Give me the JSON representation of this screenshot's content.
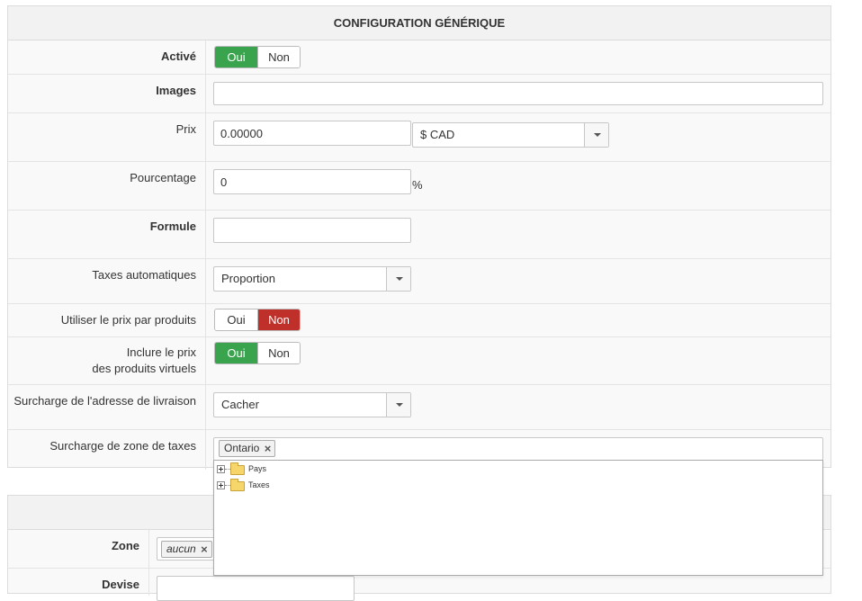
{
  "panel": {
    "title": "CONFIGURATION GÉNÉRIQUE"
  },
  "active": {
    "label": "Activé",
    "yes": "Oui",
    "no": "Non",
    "selected": "Oui"
  },
  "images": {
    "label": "Images",
    "value": ""
  },
  "price": {
    "label": "Prix",
    "value": "0.00000",
    "currency": "$ CAD"
  },
  "percentage": {
    "label": "Pourcentage",
    "value": "0",
    "suffix": "%"
  },
  "formula": {
    "label": "Formule",
    "value": ""
  },
  "auto_taxes": {
    "label": "Taxes automatiques",
    "selected": "Proportion"
  },
  "use_product_price": {
    "label": "Utiliser le prix par produits",
    "yes": "Oui",
    "no": "Non",
    "selected": "Non"
  },
  "include_virtual": {
    "label_line1": "Inclure le prix",
    "label_line2": "des produits virtuels",
    "yes": "Oui",
    "no": "Non",
    "selected": "Oui"
  },
  "shipping_override": {
    "label": "Surcharge de l'adresse de livraison",
    "selected": "Cacher"
  },
  "tax_zone_override": {
    "label": "Surcharge de zone de taxes",
    "tags": [
      "Ontario"
    ],
    "tree": [
      "Pays",
      "Taxes"
    ]
  },
  "zone": {
    "label": "Zone",
    "tags": [
      "aucun"
    ]
  },
  "currency_field": {
    "label": "Devise"
  },
  "colors": {
    "green": "#3aa34d",
    "red": "#c0302a"
  }
}
